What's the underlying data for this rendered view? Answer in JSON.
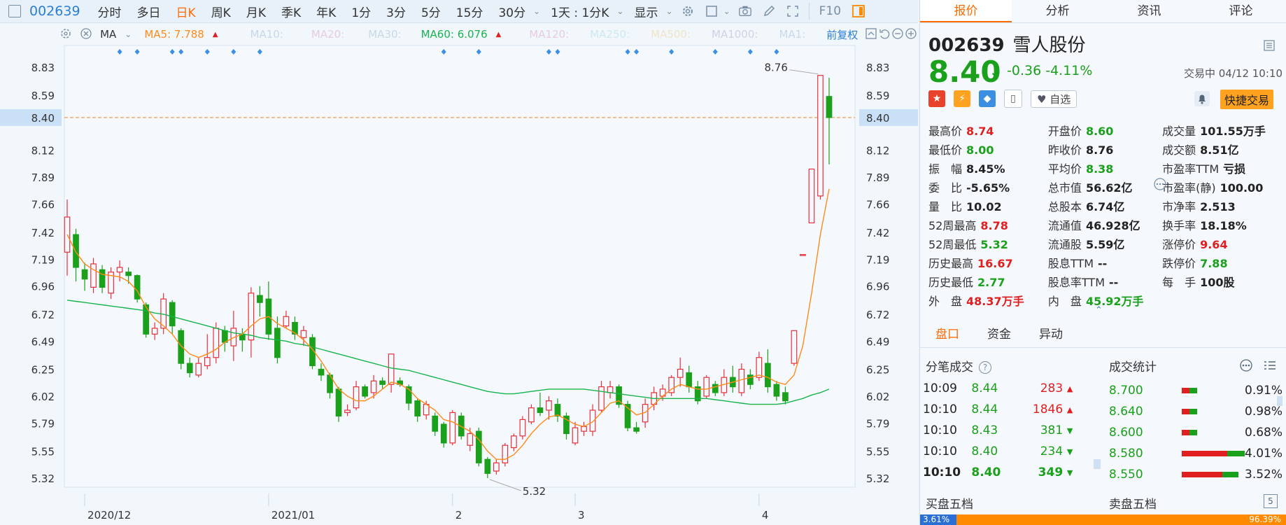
{
  "toolbar": {
    "code": "002639",
    "periods": [
      "分时",
      "多日",
      "日K",
      "周K",
      "月K",
      "季K",
      "年K",
      "1分",
      "3分",
      "5分",
      "15分",
      "30分"
    ],
    "active_period": "日K",
    "interval": "1天 : 1分K",
    "display": "显示",
    "f10": "F10"
  },
  "ma": {
    "label": "MA",
    "ma5": "MA5: 7.788",
    "ma10": "MA10:",
    "ma20": "MA20:",
    "ma30": "MA30:",
    "ma60": "MA60: 6.076",
    "ma120": "MA120:",
    "ma250": "MA250:",
    "ma500": "MA500:",
    "ma1000": "MA1000:",
    "ma1": "MA1:",
    "adjust": "前复权",
    "colors": {
      "ma5": "#ff8a1a",
      "ma60": "#19b34d",
      "dim": "#c8d8ea"
    }
  },
  "chart_data": {
    "type": "candlestick",
    "y_ticks": [
      "8.83",
      "8.59",
      "8.40",
      "8.12",
      "7.89",
      "7.66",
      "7.42",
      "7.19",
      "6.96",
      "6.72",
      "6.49",
      "6.25",
      "6.02",
      "5.79",
      "5.55",
      "5.32"
    ],
    "ylim": [
      5.32,
      8.83
    ],
    "x_labels": [
      "2020/12",
      "2021/01",
      "2",
      "3",
      "4"
    ],
    "x_label_index": [
      2,
      23,
      44,
      58,
      79
    ],
    "current_price": "8.40",
    "high_label": "8.76",
    "low_label": "5.32",
    "low_label_index": 49,
    "ma5_last": 7.788,
    "ma60_last": 6.076,
    "event_marker_index": [
      6,
      8,
      12,
      13,
      16,
      19,
      22,
      43,
      47,
      55,
      56,
      64,
      65,
      69,
      74,
      78,
      81
    ],
    "candles": [
      [
        7.25,
        7.55,
        7.7,
        7.05
      ],
      [
        7.4,
        7.12,
        7.45,
        7.0
      ],
      [
        7.1,
        7.02,
        7.16,
        6.92
      ],
      [
        6.95,
        7.15,
        7.2,
        6.9
      ],
      [
        7.1,
        6.95,
        7.14,
        6.9
      ],
      [
        6.9,
        7.08,
        7.12,
        6.85
      ],
      [
        7.08,
        7.12,
        7.18,
        7.0
      ],
      [
        7.08,
        7.05,
        7.12,
        6.98
      ],
      [
        7.05,
        6.85,
        7.06,
        6.82
      ],
      [
        6.8,
        6.55,
        6.82,
        6.52
      ],
      [
        6.55,
        6.6,
        6.65,
        6.5
      ],
      [
        6.6,
        6.85,
        6.9,
        6.55
      ],
      [
        6.82,
        6.62,
        6.84,
        6.55
      ],
      [
        6.58,
        6.3,
        6.6,
        6.25
      ],
      [
        6.3,
        6.22,
        6.35,
        6.18
      ],
      [
        6.2,
        6.3,
        6.35,
        6.18
      ],
      [
        6.28,
        6.35,
        6.55,
        6.25
      ],
      [
        6.35,
        6.6,
        6.65,
        6.3
      ],
      [
        6.58,
        6.48,
        6.62,
        6.4
      ],
      [
        6.45,
        6.6,
        6.75,
        6.32
      ],
      [
        6.55,
        6.5,
        6.6,
        6.4
      ],
      [
        6.5,
        6.9,
        6.95,
        6.35
      ],
      [
        6.88,
        6.82,
        6.96,
        6.7
      ],
      [
        6.85,
        6.55,
        7.0,
        6.5
      ],
      [
        6.6,
        6.35,
        6.7,
        6.3
      ],
      [
        6.62,
        6.7,
        6.75,
        6.6
      ],
      [
        6.65,
        6.55,
        6.7,
        6.5
      ],
      [
        6.52,
        6.58,
        6.62,
        6.45
      ],
      [
        6.52,
        6.28,
        6.55,
        6.25
      ],
      [
        6.25,
        6.2,
        6.3,
        6.15
      ],
      [
        6.2,
        6.05,
        6.22,
        6.0
      ],
      [
        6.08,
        5.85,
        6.1,
        5.8
      ],
      [
        5.88,
        5.9,
        5.95,
        5.85
      ],
      [
        5.92,
        6.1,
        6.15,
        5.9
      ],
      [
        6.1,
        6.02,
        6.12,
        6.0
      ],
      [
        6.05,
        6.15,
        6.2,
        6.0
      ],
      [
        6.15,
        6.12,
        6.18,
        6.08
      ],
      [
        6.12,
        6.38,
        6.38,
        6.05
      ],
      [
        6.15,
        6.12,
        6.18,
        6.1
      ],
      [
        6.1,
        5.96,
        6.12,
        5.9
      ],
      [
        5.98,
        5.85,
        6.0,
        5.8
      ],
      [
        5.86,
        5.95,
        5.98,
        5.82
      ],
      [
        5.85,
        5.72,
        5.88,
        5.68
      ],
      [
        5.78,
        5.62,
        5.8,
        5.58
      ],
      [
        5.62,
        5.88,
        5.9,
        5.6
      ],
      [
        5.85,
        5.68,
        5.88,
        5.65
      ],
      [
        5.6,
        5.7,
        5.75,
        5.55
      ],
      [
        5.72,
        5.45,
        5.75,
        5.42
      ],
      [
        5.48,
        5.36,
        5.5,
        5.32
      ],
      [
        5.38,
        5.45,
        5.48,
        5.35
      ],
      [
        5.45,
        5.6,
        5.62,
        5.42
      ],
      [
        5.58,
        5.68,
        5.7,
        5.55
      ],
      [
        5.68,
        5.82,
        5.85,
        5.65
      ],
      [
        5.8,
        5.92,
        5.95,
        5.78
      ],
      [
        5.92,
        5.88,
        6.05,
        5.85
      ],
      [
        5.9,
        5.98,
        6.02,
        5.82
      ],
      [
        5.95,
        5.85,
        6.0,
        5.8
      ],
      [
        5.85,
        5.7,
        5.88,
        5.65
      ],
      [
        5.62,
        5.75,
        5.8,
        5.6
      ],
      [
        5.72,
        5.76,
        5.8,
        5.68
      ],
      [
        5.72,
        5.9,
        5.95,
        5.68
      ],
      [
        5.9,
        6.1,
        6.15,
        5.88
      ],
      [
        6.05,
        6.1,
        6.15,
        6.0
      ],
      [
        6.1,
        5.95,
        6.12,
        5.92
      ],
      [
        5.95,
        5.75,
        5.98,
        5.72
      ],
      [
        5.75,
        5.72,
        5.8,
        5.7
      ],
      [
        5.8,
        5.95,
        6.0,
        5.75
      ],
      [
        5.95,
        6.05,
        6.1,
        5.9
      ],
      [
        6.02,
        6.08,
        6.12,
        5.98
      ],
      [
        6.05,
        6.18,
        6.2,
        6.02
      ],
      [
        6.18,
        6.25,
        6.35,
        6.1
      ],
      [
        6.22,
        6.1,
        6.28,
        6.05
      ],
      [
        6.1,
        5.98,
        6.15,
        5.95
      ],
      [
        6.02,
        6.18,
        6.2,
        6.0
      ],
      [
        6.12,
        6.05,
        6.15,
        6.02
      ],
      [
        6.05,
        6.18,
        6.25,
        6.02
      ],
      [
        6.18,
        6.1,
        6.28,
        6.05
      ],
      [
        6.05,
        6.25,
        6.3,
        6.02
      ],
      [
        6.2,
        6.12,
        6.25,
        6.08
      ],
      [
        6.18,
        6.35,
        6.4,
        6.15
      ],
      [
        6.3,
        6.1,
        6.42,
        6.05
      ],
      [
        6.12,
        6.02,
        6.15,
        5.98
      ],
      [
        6.05,
        5.98,
        6.1,
        5.95
      ],
      [
        6.3,
        6.58,
        6.58,
        6.28
      ],
      [
        7.23,
        7.23,
        7.23,
        7.23
      ],
      [
        7.5,
        7.96,
        7.96,
        7.5
      ],
      [
        7.73,
        8.76,
        8.76,
        7.7
      ],
      [
        8.58,
        8.4,
        8.74,
        8.0
      ]
    ],
    "ma5": [
      7.4,
      7.25,
      7.15,
      7.1,
      7.06,
      7.05,
      7.04,
      7.0,
      6.92,
      6.78,
      6.68,
      6.62,
      6.55,
      6.45,
      6.38,
      6.35,
      6.38,
      6.42,
      6.48,
      6.52,
      6.55,
      6.62,
      6.68,
      6.7,
      6.64,
      6.6,
      6.56,
      6.5,
      6.42,
      6.32,
      6.2,
      6.08,
      6.02,
      5.98,
      5.98,
      6.02,
      6.08,
      6.14,
      6.12,
      6.08,
      6.0,
      5.95,
      5.9,
      5.82,
      5.8,
      5.76,
      5.72,
      5.65,
      5.55,
      5.48,
      5.48,
      5.52,
      5.6,
      5.7,
      5.78,
      5.84,
      5.86,
      5.82,
      5.78,
      5.76,
      5.8,
      5.88,
      5.96,
      5.98,
      5.92,
      5.86,
      5.88,
      5.95,
      6.02,
      6.08,
      6.12,
      6.1,
      6.08,
      6.08,
      6.1,
      6.12,
      6.14,
      6.16,
      6.18,
      6.2,
      6.18,
      6.14,
      6.12,
      6.2,
      6.45,
      6.9,
      7.4,
      7.79
    ],
    "ma60": [
      6.84,
      6.83,
      6.82,
      6.81,
      6.8,
      6.79,
      6.78,
      6.77,
      6.76,
      6.75,
      6.73,
      6.72,
      6.7,
      6.68,
      6.66,
      6.64,
      6.62,
      6.6,
      6.58,
      6.56,
      6.55,
      6.54,
      6.52,
      6.51,
      6.5,
      6.49,
      6.47,
      6.46,
      6.44,
      6.42,
      6.4,
      6.38,
      6.36,
      6.34,
      6.32,
      6.3,
      6.28,
      6.26,
      6.25,
      6.24,
      6.22,
      6.2,
      6.18,
      6.16,
      6.14,
      6.12,
      6.1,
      6.08,
      6.06,
      6.05,
      6.04,
      6.04,
      6.05,
      6.06,
      6.07,
      6.08,
      6.08,
      6.08,
      6.08,
      6.08,
      6.07,
      6.06,
      6.05,
      6.04,
      6.03,
      6.02,
      6.01,
      6.0,
      6.0,
      6.0,
      6.0,
      6.0,
      6.0,
      6.0,
      5.99,
      5.98,
      5.97,
      5.96,
      5.95,
      5.95,
      5.95,
      5.95,
      5.96,
      5.98,
      6.0,
      6.03,
      6.05,
      6.08
    ]
  },
  "panel": {
    "tabs": [
      "报价",
      "分析",
      "资讯",
      "评论"
    ],
    "code": "002639",
    "name": "雪人股份",
    "price": "8.40",
    "arrow": "↓",
    "change": "-0.36",
    "pct": "-4.11%",
    "trading_status": "交易中 04/12 10:10",
    "fav": "自选",
    "quick_trade": "快捷交易",
    "quotes": [
      [
        [
          "最高价",
          "8.74",
          "red"
        ],
        [
          "开盘价",
          "8.60",
          "grn"
        ],
        [
          "成交量",
          "101.55万手",
          "dark"
        ]
      ],
      [
        [
          "最低价",
          "8.00",
          "grn"
        ],
        [
          "昨收价",
          "8.76",
          "dark"
        ],
        [
          "成交额",
          "8.51亿",
          "dark"
        ]
      ],
      [
        [
          "振　幅",
          "8.45%",
          "dark"
        ],
        [
          "平均价",
          "8.38",
          "grn"
        ],
        [
          "市盈率TTM",
          "亏损",
          "dark"
        ]
      ],
      [
        [
          "委　比",
          "-5.65%",
          "dark"
        ],
        [
          "总市值",
          "56.62亿",
          "dark"
        ],
        [
          "市盈率(静)",
          "100.00",
          "dark"
        ]
      ],
      [
        [
          "量　比",
          "10.02",
          "dark"
        ],
        [
          "总股本",
          "6.74亿",
          "dark"
        ],
        [
          "市净率",
          "2.513",
          "dark"
        ]
      ],
      [
        [
          "52周最高",
          "8.78",
          "red"
        ],
        [
          "流通值",
          "46.928亿",
          "dark"
        ],
        [
          "换手率",
          "18.18%",
          "dark"
        ]
      ],
      [
        [
          "52周最低",
          "5.32",
          "grn"
        ],
        [
          "流通股",
          "5.59亿",
          "dark"
        ],
        [
          "涨停价",
          "9.64",
          "red"
        ]
      ],
      [
        [
          "历史最高",
          "16.67",
          "red"
        ],
        [
          "股息TTM",
          "--",
          "dark"
        ],
        [
          "跌停价",
          "7.88",
          "grn"
        ]
      ],
      [
        [
          "历史最低",
          "2.77",
          "grn"
        ],
        [
          "股息率TTM",
          "--",
          "dark"
        ],
        [
          "每　手",
          "100股",
          "dark"
        ]
      ],
      [
        [
          "外　盘",
          "48.37万手",
          "red"
        ],
        [
          "内　盘",
          "45.92万手",
          "grn"
        ],
        [
          "",
          "",
          "dark"
        ]
      ]
    ],
    "subtabs": [
      "盘口",
      "资金",
      "异动"
    ],
    "trades_title": "分笔成交",
    "stats_title": "成交统计",
    "trades": [
      {
        "time": "10:09",
        "price": "8.44",
        "vol": "283",
        "dir": "up"
      },
      {
        "time": "10:10",
        "price": "8.44",
        "vol": "1846",
        "dir": "up"
      },
      {
        "time": "10:10",
        "price": "8.43",
        "vol": "381",
        "dir": "down"
      },
      {
        "time": "10:10",
        "price": "8.40",
        "vol": "234",
        "dir": "down"
      },
      {
        "time": "10:10",
        "price": "8.40",
        "vol": "349",
        "dir": "down"
      }
    ],
    "stats": [
      {
        "price": "8.700",
        "pct": "0.91%",
        "bar": 0.1
      },
      {
        "price": "8.640",
        "pct": "0.98%",
        "bar": 0.11
      },
      {
        "price": "8.600",
        "pct": "0.68%",
        "bar": 0.08
      },
      {
        "price": "8.580",
        "pct": "4.01%",
        "bar": 1.0
      },
      {
        "price": "8.550",
        "pct": "3.52%",
        "bar": 0.9
      }
    ],
    "buy5": "买盘五档",
    "sell5": "卖盘五档",
    "buy_pct": "3.61%",
    "sell_pct": "96.39%"
  }
}
